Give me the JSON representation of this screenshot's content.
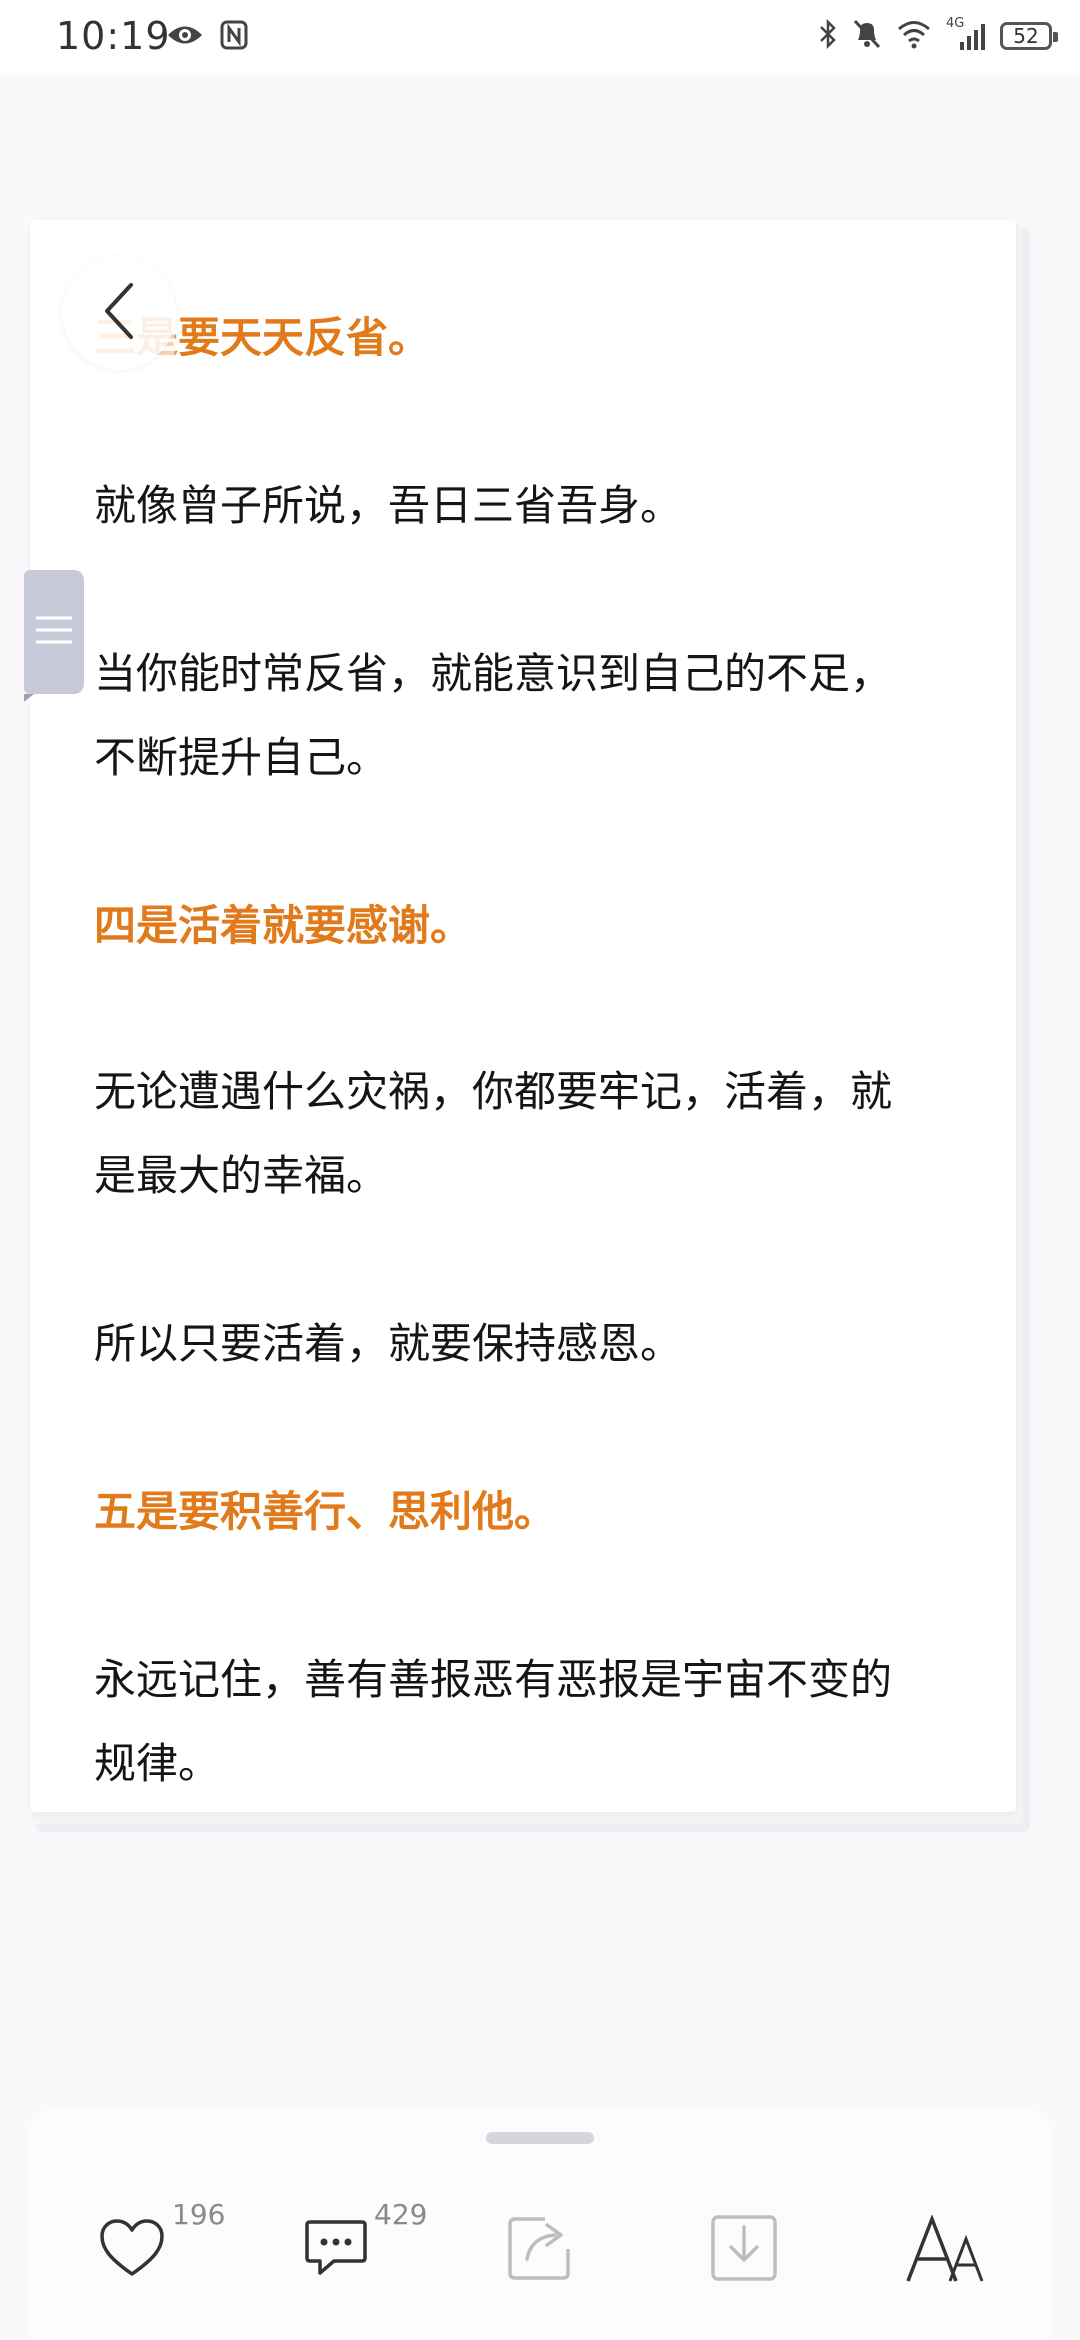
{
  "status_bar": {
    "time": "10:19",
    "battery": "52",
    "network": "4G",
    "icons": [
      "eye-icon",
      "nfc-icon",
      "bluetooth-icon",
      "mute-icon",
      "wifi-icon",
      "signal-icon",
      "battery-icon"
    ]
  },
  "article": {
    "blocks": [
      {
        "type": "heading",
        "text": "三是要天天反省。"
      },
      {
        "type": "text",
        "text": "就像曾子所说，吾日三省吾身。"
      },
      {
        "type": "text",
        "lines": [
          "当你能时常反省，就能意识到自己的不足，",
          "不断提升自己。"
        ]
      },
      {
        "type": "heading",
        "text": "四是活着就要感谢。"
      },
      {
        "type": "text",
        "lines": [
          "无论遭遇什么灾祸，你都要牢记，活着，就",
          "是最大的幸福。"
        ]
      },
      {
        "type": "text",
        "text": "所以只要活着，就要保持感恩。"
      },
      {
        "type": "heading",
        "text": "五是要积善行、思利他。"
      },
      {
        "type": "text",
        "lines": [
          "永远记住，善有善报恶有恶报是宇宙不变的",
          "规律。"
        ]
      }
    ],
    "heading_color": "#e07a1b"
  },
  "bottom_bar": {
    "like_count": "196",
    "comment_count": "429",
    "icons": [
      "heart-icon",
      "comment-icon",
      "share-icon",
      "download-icon",
      "font-size-icon"
    ],
    "font_size_label": "AA"
  }
}
